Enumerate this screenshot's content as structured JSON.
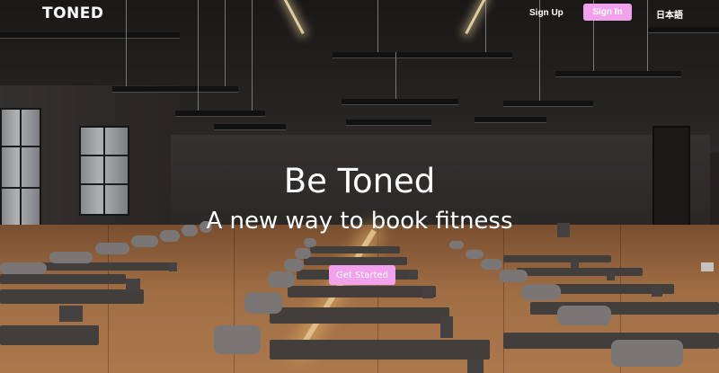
{
  "nav": {
    "brand": "TONED",
    "sign_up": "Sign Up",
    "sign_in": "Sign In",
    "language": "日本語"
  },
  "hero": {
    "title": "Be Toned",
    "subtitle": "A new way to book fitness",
    "cta_label": "Get Started"
  },
  "colors": {
    "accent": "#f2a2ec",
    "text": "#ffffff"
  }
}
